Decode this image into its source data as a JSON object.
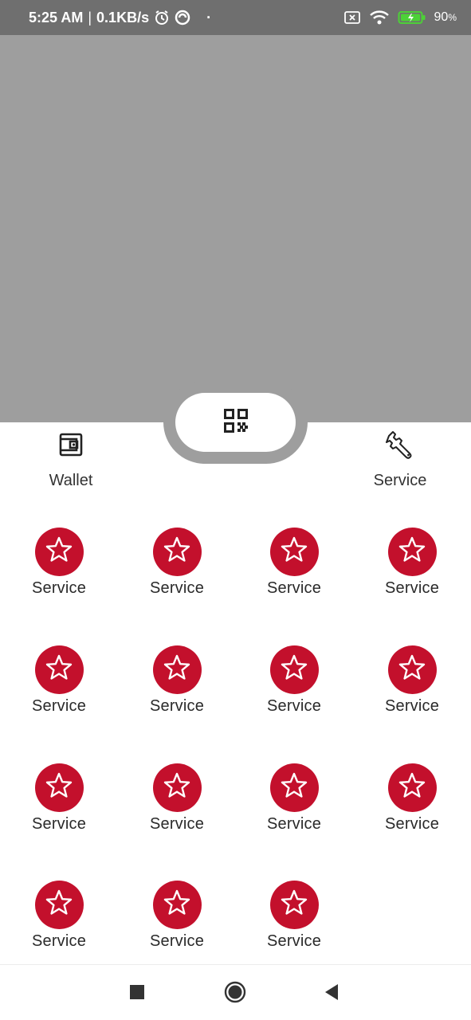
{
  "status_bar": {
    "time": "5:25 AM",
    "network_speed": "0.1KB/s",
    "battery_percent": "90",
    "battery_unit": "%",
    "icons": [
      "alarm-icon",
      "data-saver-icon",
      "dot-icon",
      "sim-off-icon",
      "wifi-icon",
      "battery-charging-icon"
    ]
  },
  "qr_button": {
    "icon": "qr-code-icon"
  },
  "shortcuts": [
    {
      "label": "Wallet",
      "icon": "wallet-icon"
    },
    {
      "label": "Service",
      "icon": "wrench-icon"
    }
  ],
  "services": [
    {
      "label": "Service",
      "icon": "star-icon"
    },
    {
      "label": "Service",
      "icon": "star-icon"
    },
    {
      "label": "Service",
      "icon": "star-icon"
    },
    {
      "label": "Service",
      "icon": "star-icon"
    },
    {
      "label": "Service",
      "icon": "star-icon"
    },
    {
      "label": "Service",
      "icon": "star-icon"
    },
    {
      "label": "Service",
      "icon": "star-icon"
    },
    {
      "label": "Service",
      "icon": "star-icon"
    },
    {
      "label": "Service",
      "icon": "star-icon"
    },
    {
      "label": "Service",
      "icon": "star-icon"
    },
    {
      "label": "Service",
      "icon": "star-icon"
    },
    {
      "label": "Service",
      "icon": "star-icon"
    },
    {
      "label": "Service",
      "icon": "star-icon"
    },
    {
      "label": "Service",
      "icon": "star-icon"
    },
    {
      "label": "Service",
      "icon": "star-icon"
    }
  ],
  "nav_bar": {
    "icons": [
      "recent-apps-icon",
      "home-icon",
      "back-icon"
    ]
  },
  "colors": {
    "status_bar": "#6f6f6f",
    "hero": "#9e9e9e",
    "accent_red": "#c3102c",
    "battery_green": "#4cd137"
  }
}
